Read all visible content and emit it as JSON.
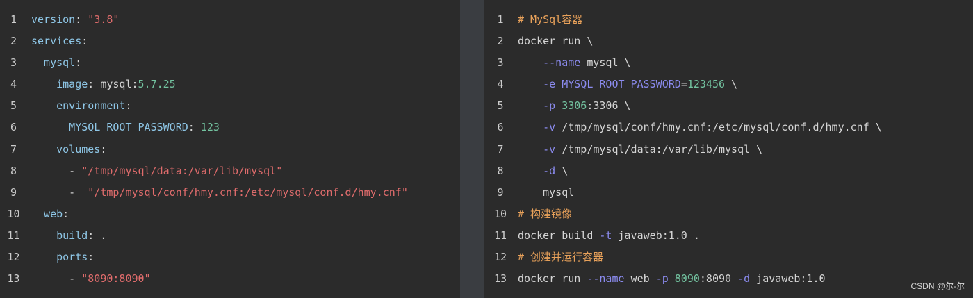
{
  "left_panel": {
    "lines": [
      {
        "num": "1",
        "tokens": [
          {
            "t": "version",
            "c": "k"
          },
          {
            "t": ": ",
            "c": "p"
          },
          {
            "t": "\"3.8\"",
            "c": "s"
          }
        ]
      },
      {
        "num": "2",
        "tokens": [
          {
            "t": "services",
            "c": "k"
          },
          {
            "t": ":",
            "c": "p"
          }
        ]
      },
      {
        "num": "3",
        "tokens": [
          {
            "t": "  mysql",
            "c": "k"
          },
          {
            "t": ":",
            "c": "p"
          }
        ]
      },
      {
        "num": "4",
        "tokens": [
          {
            "t": "    image",
            "c": "k"
          },
          {
            "t": ": mysql:",
            "c": "p"
          },
          {
            "t": "5.7.25",
            "c": "n"
          }
        ]
      },
      {
        "num": "5",
        "tokens": [
          {
            "t": "    environment",
            "c": "k"
          },
          {
            "t": ":",
            "c": "p"
          }
        ]
      },
      {
        "num": "6",
        "tokens": [
          {
            "t": "      MYSQL_ROOT_PASSWORD",
            "c": "k"
          },
          {
            "t": ": ",
            "c": "p"
          },
          {
            "t": "123",
            "c": "n"
          }
        ]
      },
      {
        "num": "7",
        "tokens": [
          {
            "t": "    volumes",
            "c": "k"
          },
          {
            "t": ":",
            "c": "p"
          }
        ]
      },
      {
        "num": "8",
        "tokens": [
          {
            "t": "      - ",
            "c": "p"
          },
          {
            "t": "\"/tmp/mysql/data:/var/lib/mysql\"",
            "c": "s"
          }
        ]
      },
      {
        "num": "9",
        "tokens": [
          {
            "t": "      -  ",
            "c": "p"
          },
          {
            "t": "\"/tmp/mysql/conf/hmy.cnf:/etc/mysql/conf.d/hmy.cnf\"",
            "c": "s"
          }
        ]
      },
      {
        "num": "10",
        "tokens": [
          {
            "t": "  web",
            "c": "k"
          },
          {
            "t": ":",
            "c": "p"
          }
        ]
      },
      {
        "num": "11",
        "tokens": [
          {
            "t": "    build",
            "c": "k"
          },
          {
            "t": ": .",
            "c": "p"
          }
        ]
      },
      {
        "num": "12",
        "tokens": [
          {
            "t": "    ports",
            "c": "k"
          },
          {
            "t": ":",
            "c": "p"
          }
        ]
      },
      {
        "num": "13",
        "tokens": [
          {
            "t": "      - ",
            "c": "p"
          },
          {
            "t": "\"8090:8090\"",
            "c": "s"
          }
        ]
      }
    ]
  },
  "right_panel": {
    "lines": [
      {
        "num": "1",
        "tokens": [
          {
            "t": "# MySql容器",
            "c": "c"
          }
        ]
      },
      {
        "num": "2",
        "tokens": [
          {
            "t": "docker run \\",
            "c": "p"
          }
        ]
      },
      {
        "num": "3",
        "tokens": [
          {
            "t": "    ",
            "c": "p"
          },
          {
            "t": "--name",
            "c": "f"
          },
          {
            "t": " mysql \\",
            "c": "p"
          }
        ]
      },
      {
        "num": "4",
        "tokens": [
          {
            "t": "    ",
            "c": "p"
          },
          {
            "t": "-e",
            "c": "f"
          },
          {
            "t": " ",
            "c": "p"
          },
          {
            "t": "MYSQL_ROOT_PASSWORD",
            "c": "f"
          },
          {
            "t": "=",
            "c": "p"
          },
          {
            "t": "123456",
            "c": "n"
          },
          {
            "t": " \\",
            "c": "p"
          }
        ]
      },
      {
        "num": "5",
        "tokens": [
          {
            "t": "    ",
            "c": "p"
          },
          {
            "t": "-p",
            "c": "f"
          },
          {
            "t": " ",
            "c": "p"
          },
          {
            "t": "3306",
            "c": "n"
          },
          {
            "t": ":3306 \\",
            "c": "p"
          }
        ]
      },
      {
        "num": "6",
        "tokens": [
          {
            "t": "    ",
            "c": "p"
          },
          {
            "t": "-v",
            "c": "f"
          },
          {
            "t": " /tmp/mysql/conf/hmy.cnf:/etc/mysql/conf.d/hmy.cnf \\",
            "c": "p"
          }
        ]
      },
      {
        "num": "7",
        "tokens": [
          {
            "t": "    ",
            "c": "p"
          },
          {
            "t": "-v",
            "c": "f"
          },
          {
            "t": " /tmp/mysql/data:/var/lib/mysql \\",
            "c": "p"
          }
        ]
      },
      {
        "num": "8",
        "tokens": [
          {
            "t": "    ",
            "c": "p"
          },
          {
            "t": "-d",
            "c": "f"
          },
          {
            "t": " \\",
            "c": "p"
          }
        ]
      },
      {
        "num": "9",
        "tokens": [
          {
            "t": "    mysql",
            "c": "p"
          }
        ]
      },
      {
        "num": "10",
        "tokens": [
          {
            "t": "# 构建镜像",
            "c": "c"
          }
        ]
      },
      {
        "num": "11",
        "tokens": [
          {
            "t": "docker build ",
            "c": "p"
          },
          {
            "t": "-t",
            "c": "f"
          },
          {
            "t": " javaweb:1.0 .",
            "c": "p"
          }
        ]
      },
      {
        "num": "12",
        "tokens": [
          {
            "t": "# 创建并运行容器",
            "c": "c"
          }
        ]
      },
      {
        "num": "13",
        "tokens": [
          {
            "t": "docker run ",
            "c": "p"
          },
          {
            "t": "--name",
            "c": "f"
          },
          {
            "t": " web ",
            "c": "p"
          },
          {
            "t": "-p",
            "c": "f"
          },
          {
            "t": " ",
            "c": "p"
          },
          {
            "t": "8090",
            "c": "n"
          },
          {
            "t": ":8090 ",
            "c": "p"
          },
          {
            "t": "-d",
            "c": "f"
          },
          {
            "t": " javaweb:1.0",
            "c": "p"
          }
        ]
      }
    ]
  },
  "watermark": "CSDN @尔-尔"
}
